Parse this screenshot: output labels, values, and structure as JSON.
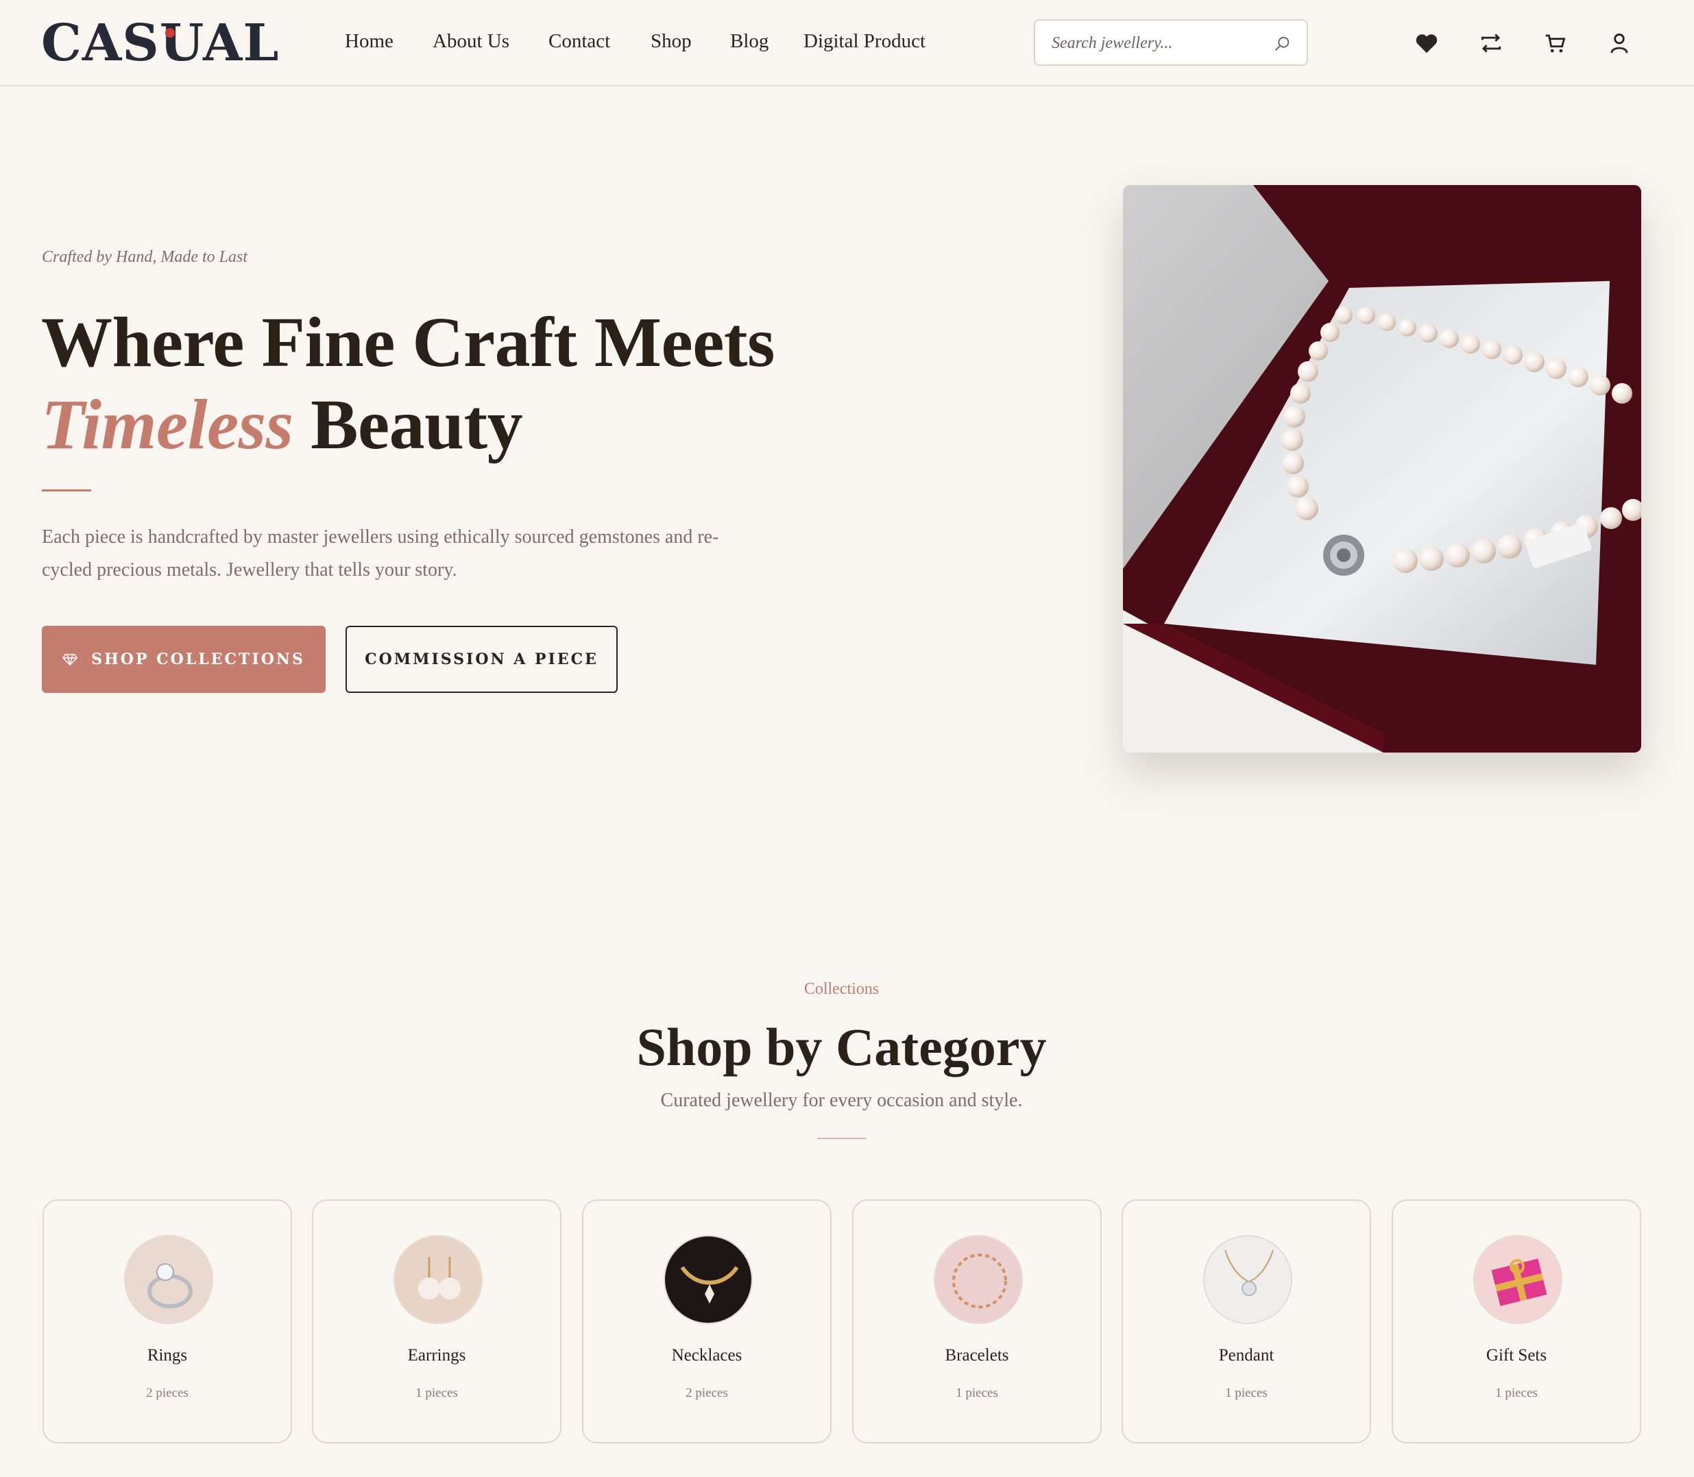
{
  "brand": {
    "logo_text": "CASUAL"
  },
  "nav": {
    "items": [
      {
        "label": "Home"
      },
      {
        "label": "About Us"
      },
      {
        "label": "Contact"
      },
      {
        "label": "Shop"
      },
      {
        "label": "Blog"
      },
      {
        "label": "Digital Product"
      }
    ]
  },
  "search": {
    "placeholder": "Search jewellery...",
    "icon": "search-icon"
  },
  "header_icons": [
    "heart-icon",
    "compare-icon",
    "cart-icon",
    "user-icon"
  ],
  "hero": {
    "eyebrow": "Crafted by Hand, Made to Last",
    "title_line1": "Where Fine Craft Meets",
    "title_accent": "Timeless",
    "title_rest": "Beauty",
    "description": "Each piece is handcrafted by master jewellers using ethically sourced gemstones and re-cycled precious metals. Jewellery that tells your story.",
    "primary_button": "SHOP COLLECTIONS",
    "secondary_button": "COMMISSION A PIECE"
  },
  "categories_section": {
    "eyebrow": "Collections",
    "title": "Shop by Category",
    "subtitle": "Curated jewellery for every occasion and style.",
    "items": [
      {
        "name": "Rings",
        "count": "2 pieces"
      },
      {
        "name": "Earrings",
        "count": "1 pieces"
      },
      {
        "name": "Necklaces",
        "count": "2 pieces"
      },
      {
        "name": "Bracelets",
        "count": "1 pieces"
      },
      {
        "name": "Pendant",
        "count": "1 pieces"
      },
      {
        "name": "Gift Sets",
        "count": "1 pieces"
      }
    ]
  },
  "colors": {
    "accent": "#c47d6d",
    "background": "#f9f6f1",
    "text": "#2a2119",
    "muted": "#7f6e66"
  }
}
